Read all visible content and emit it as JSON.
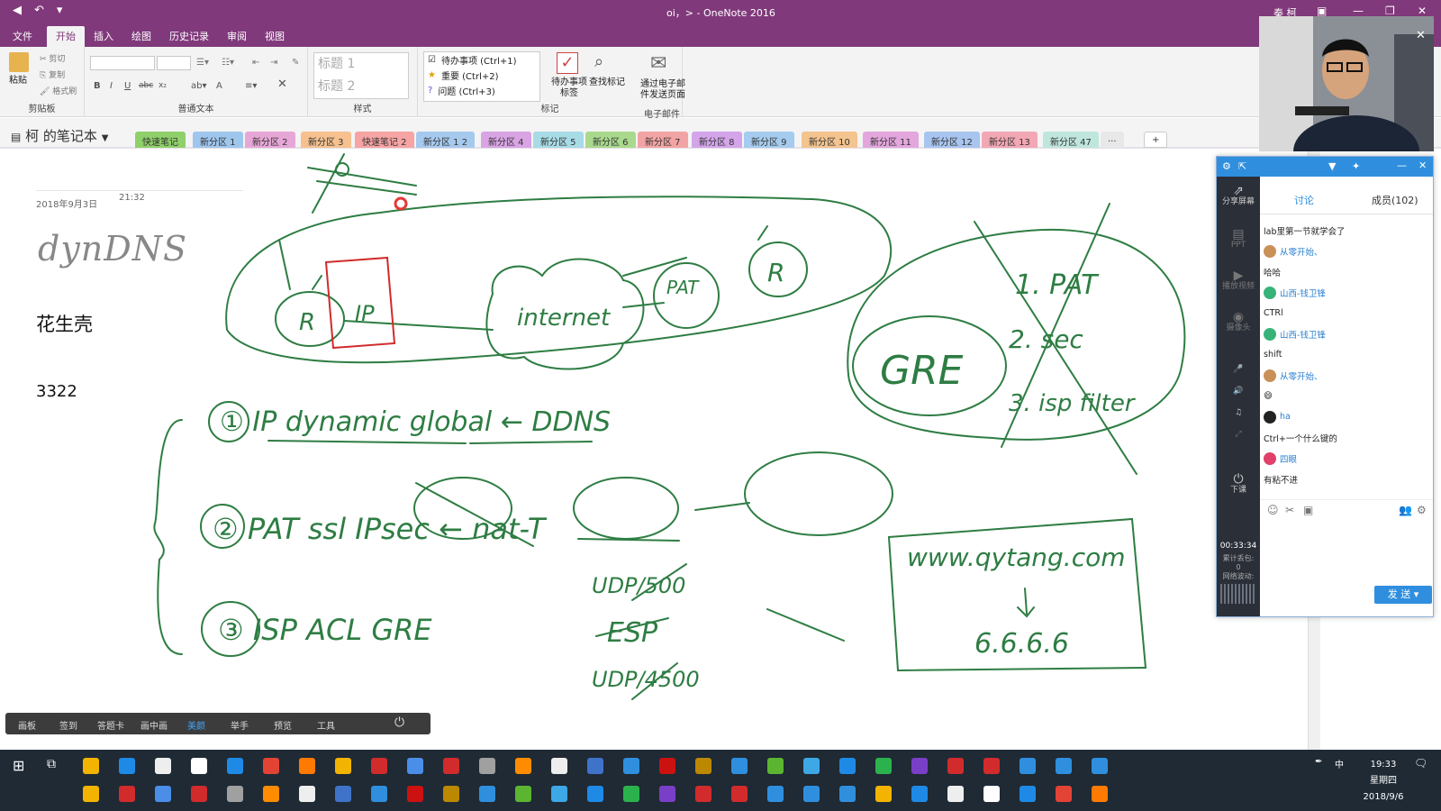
{
  "titlebar": {
    "filename": "oi，>",
    "app": "OneNote 2016",
    "user": "秦 柯",
    "separator": "-"
  },
  "ribbon_tabs": [
    "文件",
    "开始",
    "插入",
    "绘图",
    "历史记录",
    "审阅",
    "视图"
  ],
  "active_tab": "开始",
  "clipboard": {
    "paste": "粘贴",
    "cut": "剪切",
    "copy": "复制",
    "format_painter": "格式刷",
    "label": "剪贴板"
  },
  "basic_text": {
    "label": "普通文本",
    "bold": "B",
    "italic": "I",
    "underline": "U",
    "strike": "abc",
    "subscript": "x₂",
    "font_color": "A"
  },
  "styles": {
    "label": "样式",
    "items": [
      "标题 1",
      "标题 2"
    ]
  },
  "tags": {
    "label": "标记",
    "items": [
      "待办事项 (Ctrl+1)",
      "重要 (Ctrl+2)",
      "问题 (Ctrl+3)"
    ],
    "todo_tag": "待办事项\n标签",
    "find_tags": "查找标记"
  },
  "email": {
    "label": "电子邮件",
    "send": "通过电子邮\n件发送页面"
  },
  "notebook": {
    "name": "柯 的笔记本"
  },
  "sections": [
    {
      "label": "快速笔记",
      "color": "#8fd06a"
    },
    {
      "label": "新分区 1",
      "color": "#9fc7ee"
    },
    {
      "label": "新分区 2",
      "color": "#e7a7d6"
    },
    {
      "label": "新分区 3",
      "color": "#f6c18f"
    },
    {
      "label": "快速笔记 2",
      "color": "#f7a4a4"
    },
    {
      "label": "新分区 1 2",
      "color": "#a6c9ee"
    },
    {
      "label": "新分区 4",
      "color": "#d9a4e4"
    },
    {
      "label": "新分区 5",
      "color": "#a7dbe6"
    },
    {
      "label": "新分区 6",
      "color": "#a9d98d"
    },
    {
      "label": "新分区 7",
      "color": "#f2a4a4"
    },
    {
      "label": "新分区 8",
      "color": "#d4a5ea"
    },
    {
      "label": "新分区 9",
      "color": "#a5ccef"
    },
    {
      "label": "新分区 10",
      "color": "#f3c48e"
    },
    {
      "label": "新分区 11",
      "color": "#e3a6dd"
    },
    {
      "label": "新分区 12",
      "color": "#a7c5ef"
    },
    {
      "label": "新分区 13",
      "color": "#f2a7b4"
    },
    {
      "label": "新分区 47",
      "color": "#bfe6dd"
    }
  ],
  "section_more": "...",
  "section_add": "+",
  "page": {
    "date": "2018年9月3日",
    "time": "21:32",
    "ink_title": "dynDNS",
    "line1": "花生壳",
    "line2": "3322"
  },
  "ink": {
    "notes": [
      "R",
      "IP",
      "internet",
      "PAT",
      "R",
      "1. PAT",
      "2. sec",
      "3. isp filter",
      "GRE",
      "① IP dynamic global ← DDNS",
      "② PAT  ssl  IPsec ← nat-T",
      "③ ISP  ACL  GRE",
      "UDP/500",
      "ESP",
      "UDP/4500",
      "www.qytang.com",
      "6.6.6.6"
    ]
  },
  "live_panel": {
    "tab_discuss": "讨论",
    "tab_members": "成员(102)",
    "side": [
      "分享屏幕",
      "PPT",
      "播放视频",
      "摄像头",
      "下课"
    ],
    "timer": "00:33:34",
    "stats": [
      "累计丢包:",
      "0",
      "网络波动:"
    ],
    "send": "发 送",
    "messages": [
      {
        "type": "text",
        "text": "lab里第一节就学会了"
      },
      {
        "type": "user",
        "name": "从零开始、",
        "color": "#c99058"
      },
      {
        "type": "text",
        "text": "哈哈"
      },
      {
        "type": "user",
        "name": "山西-钱卫锋",
        "color": "#37b37a"
      },
      {
        "type": "text",
        "text": "CTRl"
      },
      {
        "type": "user",
        "name": "山西-钱卫锋",
        "color": "#37b37a"
      },
      {
        "type": "text",
        "text": "shift"
      },
      {
        "type": "user",
        "name": "从零开始、",
        "color": "#c99058"
      },
      {
        "type": "text",
        "text": "😄"
      },
      {
        "type": "user",
        "name": "ha",
        "color": "#222222"
      },
      {
        "type": "text",
        "text": "Ctrl+一个什么键的"
      },
      {
        "type": "user",
        "name": "四眼",
        "color": "#e0406a"
      },
      {
        "type": "text",
        "text": "有粘不进"
      }
    ]
  },
  "pen_toolbar": {
    "items": [
      "画板",
      "签到",
      "答题卡",
      "画中画",
      "美颜",
      "举手",
      "预览",
      "工具"
    ],
    "active": "美颜"
  },
  "taskbar": {
    "time": "19:33",
    "weekday": "星期四",
    "date": "2018/9/6",
    "ime": "中"
  },
  "ink_color": "#2e7d43",
  "accent": "#80397b"
}
